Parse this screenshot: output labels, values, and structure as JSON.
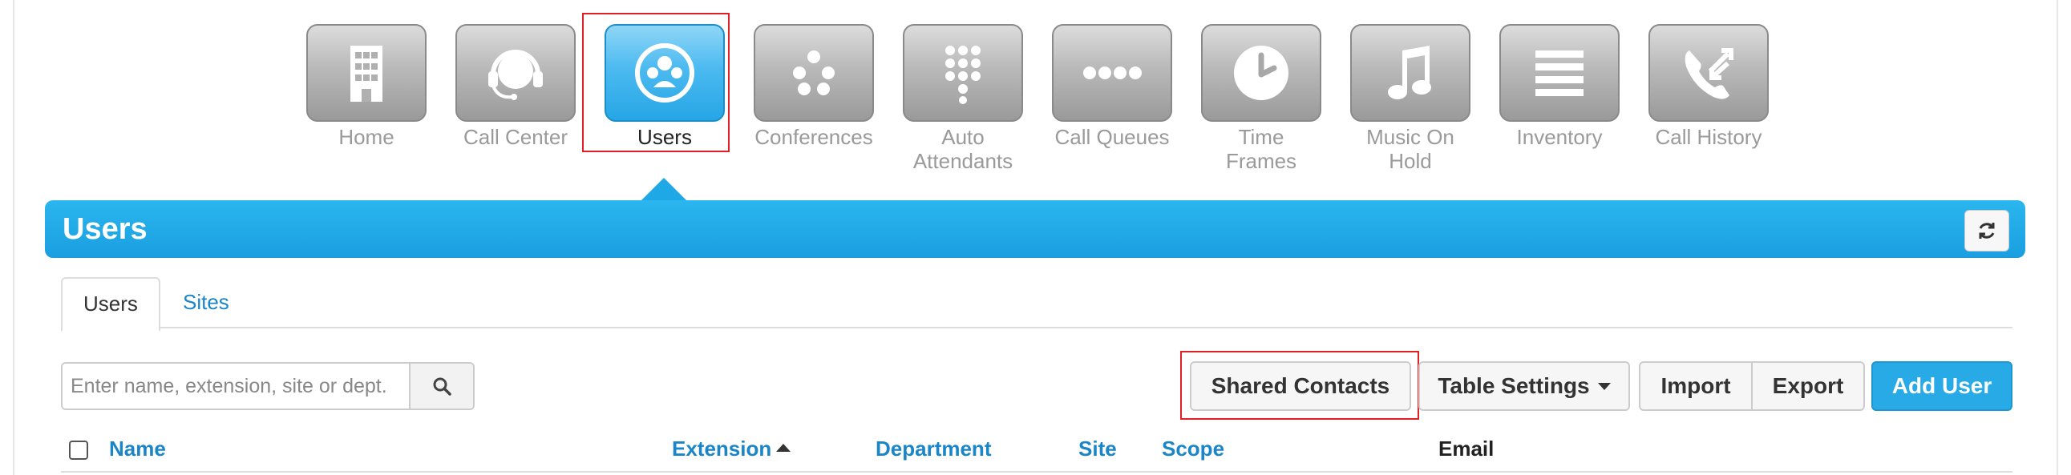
{
  "nav": {
    "items": [
      {
        "label": "Home",
        "icon": "building-icon"
      },
      {
        "label": "Call Center",
        "icon": "headset-icon"
      },
      {
        "label": "Users",
        "icon": "users-icon",
        "active": true
      },
      {
        "label": "Conferences",
        "icon": "conference-dots-icon"
      },
      {
        "label": "Auto Attendants",
        "label_lines": [
          "Auto",
          "Attendants"
        ],
        "icon": "keypad-icon"
      },
      {
        "label": "Call Queues",
        "icon": "queue-dots-icon"
      },
      {
        "label": "Time Frames",
        "label_lines": [
          "Time",
          "Frames"
        ],
        "icon": "clock-icon"
      },
      {
        "label": "Music On Hold",
        "label_lines": [
          "Music On",
          "Hold"
        ],
        "icon": "music-note-icon"
      },
      {
        "label": "Inventory",
        "icon": "list-lines-icon"
      },
      {
        "label": "Call History",
        "icon": "phone-arrows-icon"
      }
    ]
  },
  "panel": {
    "title": "Users",
    "refresh_icon": "refresh-icon"
  },
  "tabs": [
    {
      "label": "Users",
      "active": true
    },
    {
      "label": "Sites",
      "active": false
    }
  ],
  "search": {
    "placeholder": "Enter name, extension, site or dept.",
    "value": "",
    "icon": "search-icon"
  },
  "toolbar": {
    "shared_contacts": "Shared Contacts",
    "table_settings": "Table Settings",
    "import": "Import",
    "export": "Export",
    "add_user": "Add User"
  },
  "table": {
    "columns": [
      {
        "label": "Name",
        "sortable": true
      },
      {
        "label": "Extension",
        "sortable": true,
        "sort": "ascending"
      },
      {
        "label": "Department",
        "sortable": true
      },
      {
        "label": "Site",
        "sortable": true
      },
      {
        "label": "Scope",
        "sortable": true
      },
      {
        "label": "Email",
        "sortable": false
      }
    ]
  },
  "colors": {
    "accent_blue": "#1fa8e6",
    "highlight_red": "#e01e24",
    "link_blue": "#1a86c8"
  }
}
